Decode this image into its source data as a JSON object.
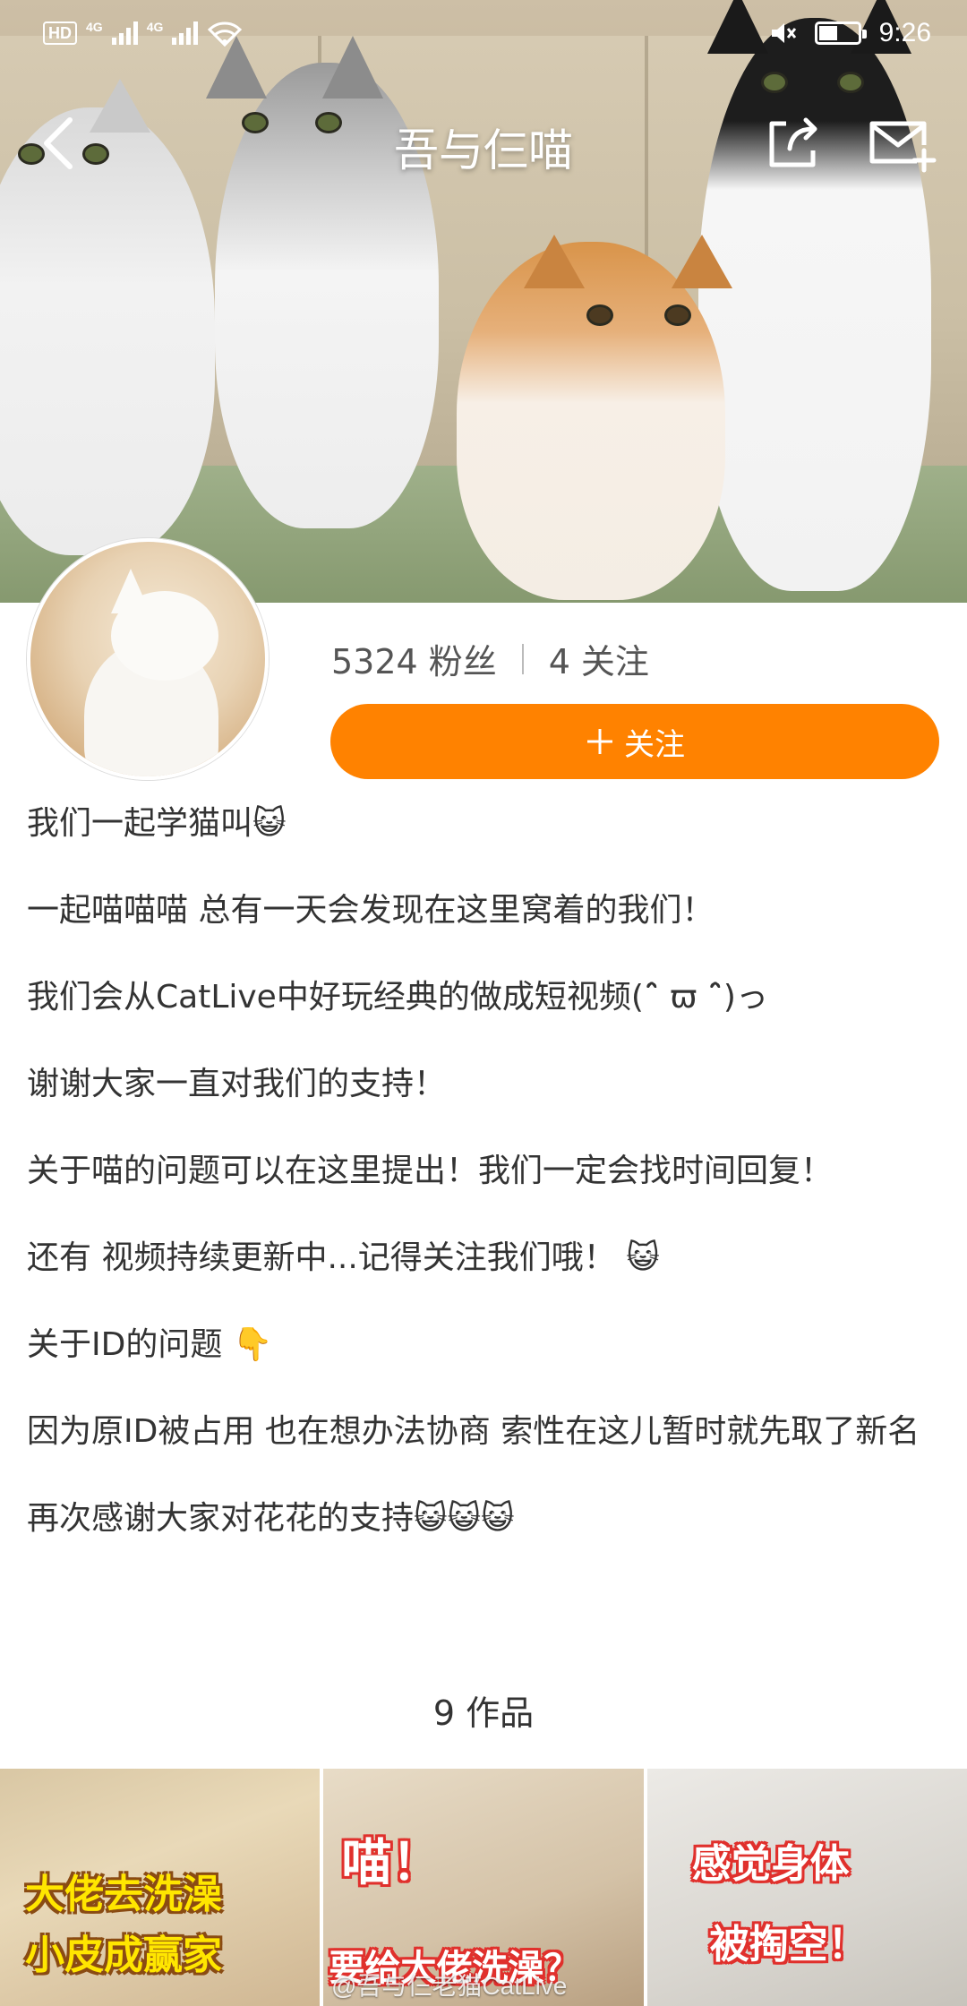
{
  "status_bar": {
    "hd": "HD",
    "network1": "4G",
    "network2": "4G",
    "time": "9:26",
    "battery_level": 0.45,
    "icons": [
      "wifi-icon",
      "mute-icon",
      "battery-icon"
    ]
  },
  "nav": {
    "title": "吾与仨喵",
    "icons": [
      "back-arrow-icon",
      "share-icon",
      "message-icon"
    ]
  },
  "profile": {
    "followers_count": "5324",
    "followers_label": "粉丝",
    "following_count": "4",
    "following_label": "关注",
    "follow_button_label": "关注",
    "follow_button_icon": "plus-icon"
  },
  "colors": {
    "accent": "#ff8200",
    "text": "#333333",
    "muted": "#555555"
  },
  "bio": [
    "我们一起学猫叫😺",
    "一起喵喵喵  总有一天会发现在这里窝着的我们！",
    "我们会从CatLive中好玩经典的做成短视频(ˆ̑ ϖ ˆ̑)っ",
    "谢谢大家一直对我们的支持！",
    "关于喵的问题可以在这里提出！我们一定会找时间回复！",
    "还有 视频持续更新中...记得关注我们哦！ 😺",
    "关于ID的问题 👇",
    "因为原ID被占用 也在想办法协商 索性在这儿暂时就先取了新名",
    "再次感谢大家对花花的支持😺😺😺"
  ],
  "works": {
    "count_label": "9 作品",
    "thumbnails": [
      {
        "line1": "大佬去洗澡",
        "line2": "小皮成赢家"
      },
      {
        "line1": "喵！",
        "line2": "要给大佬洗澡？"
      },
      {
        "line1": "感觉身体",
        "line2": "被掏空！"
      }
    ]
  },
  "watermark": "@吾与仨老猫CatLive"
}
